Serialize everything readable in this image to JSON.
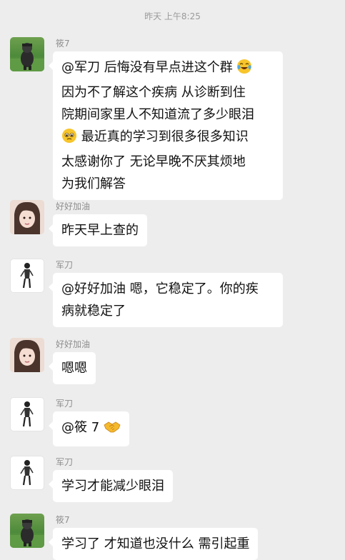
{
  "header": {
    "timestamp": "昨天 上午8:25"
  },
  "messages": [
    {
      "sender": "筱7",
      "avatar": "green-character-avatar",
      "lines": [
        "@军刀  后悔没有早点进这个群",
        "因为不了解这个疾病 从诊断到住",
        "院期间家里人不知道流了多少眼泪",
        "最近真的学习到很多很多知识",
        "太感谢你了 无论早晚不厌其烦地",
        "为我们解答"
      ]
    },
    {
      "sender": "好好加油",
      "avatar": "girl-photo-avatar",
      "lines": [
        "昨天早上查的"
      ]
    },
    {
      "sender": "军刀",
      "avatar": "figure-sketch-avatar",
      "lines": [
        "@好好加油  嗯，它稳定了。你的疾",
        "病就稳定了"
      ]
    },
    {
      "sender": "好好加油",
      "avatar": "girl-photo-avatar",
      "lines": [
        "嗯嗯"
      ]
    },
    {
      "sender": "军刀",
      "avatar": "figure-sketch-avatar",
      "lines": [
        "@筱 7"
      ]
    },
    {
      "sender": "军刀",
      "avatar": "figure-sketch-avatar",
      "lines": [
        "学习才能减少眼泪"
      ]
    },
    {
      "sender": "筱7",
      "avatar": "green-character-avatar",
      "lines": [
        "学习了 才知道也没什么 需引起重"
      ]
    }
  ],
  "emojis": {
    "laugh_cry": "laughing-crying-emoji",
    "pleading": "pleading-face-emoji",
    "handshake": "handshake-emoji"
  }
}
